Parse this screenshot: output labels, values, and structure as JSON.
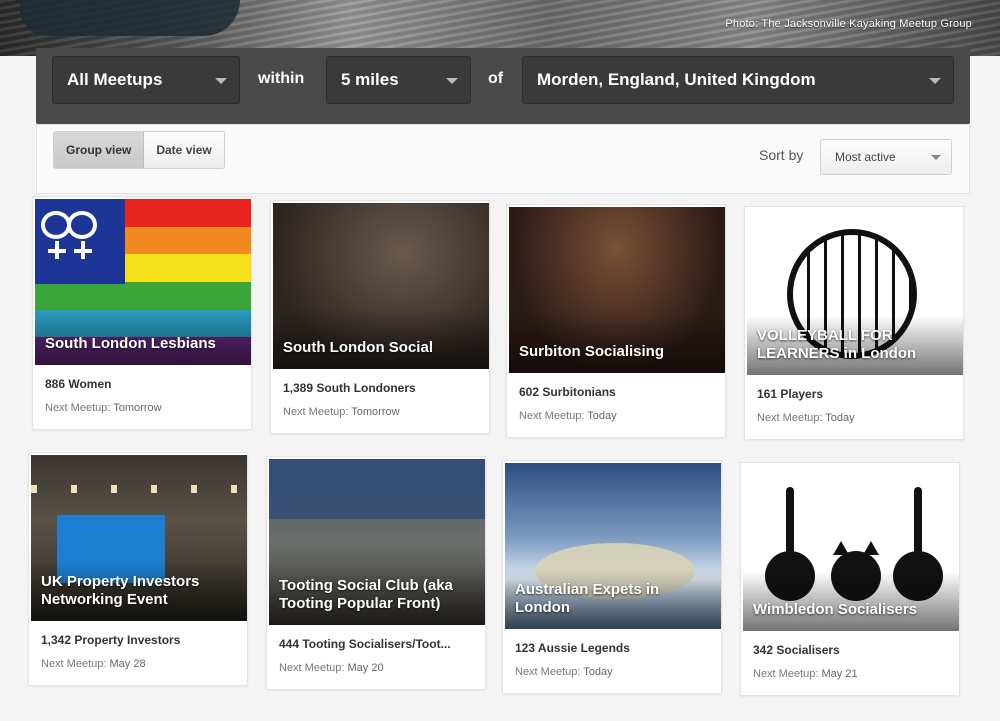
{
  "hero": {
    "photo_credit": "Photo: The Jacksonville Kayaking Meetup Group"
  },
  "search": {
    "category": "All Meetups",
    "within_label": "within",
    "distance": "5 miles",
    "of_label": "of",
    "location": "Morden, England, United Kingdom"
  },
  "view_toggle": {
    "group_view": "Group view",
    "date_view": "Date view",
    "active": "group_view"
  },
  "sort": {
    "label": "Sort by",
    "selected": "Most active"
  },
  "next_label": "Next Meetup:",
  "groups": [
    {
      "name": "South London Lesbians",
      "members": "886 Women",
      "next": "Tomorrow",
      "photo": "rainbow-flag-image"
    },
    {
      "name": "South London Social",
      "members": "1,389 South Londoners",
      "next": "Tomorrow",
      "photo": "pub-group-photo"
    },
    {
      "name": "Surbiton Socialising",
      "members": "602 Surbitonians",
      "next": "Today",
      "photo": "party-group-photo"
    },
    {
      "name": "VOLLEYBALL FOR LEARNERS in London",
      "members": "161 Players",
      "next": "Today",
      "photo": "volleyball-logo-image"
    },
    {
      "name": "UK Property Investors Networking Event",
      "members": "1,342 Property Investors",
      "next": "May 28",
      "photo": "conference-photo"
    },
    {
      "name": "Tooting Social Club (aka Tooting Popular Front)",
      "members": "444 Tooting Socialisers/Toot...",
      "next": "May 20",
      "photo": "club-band-photo"
    },
    {
      "name": "Australian Expets in London",
      "members": "123 Aussie Legends",
      "next": "Today",
      "photo": "hot-spring-photo"
    },
    {
      "name": "Wimbledon Socialisers",
      "members": "342 Socialisers",
      "next": "May 21",
      "photo": "cats-illustration"
    }
  ],
  "colors": {
    "search_bar": "#4a4a4a",
    "page_bg": "#f4f4f4"
  }
}
